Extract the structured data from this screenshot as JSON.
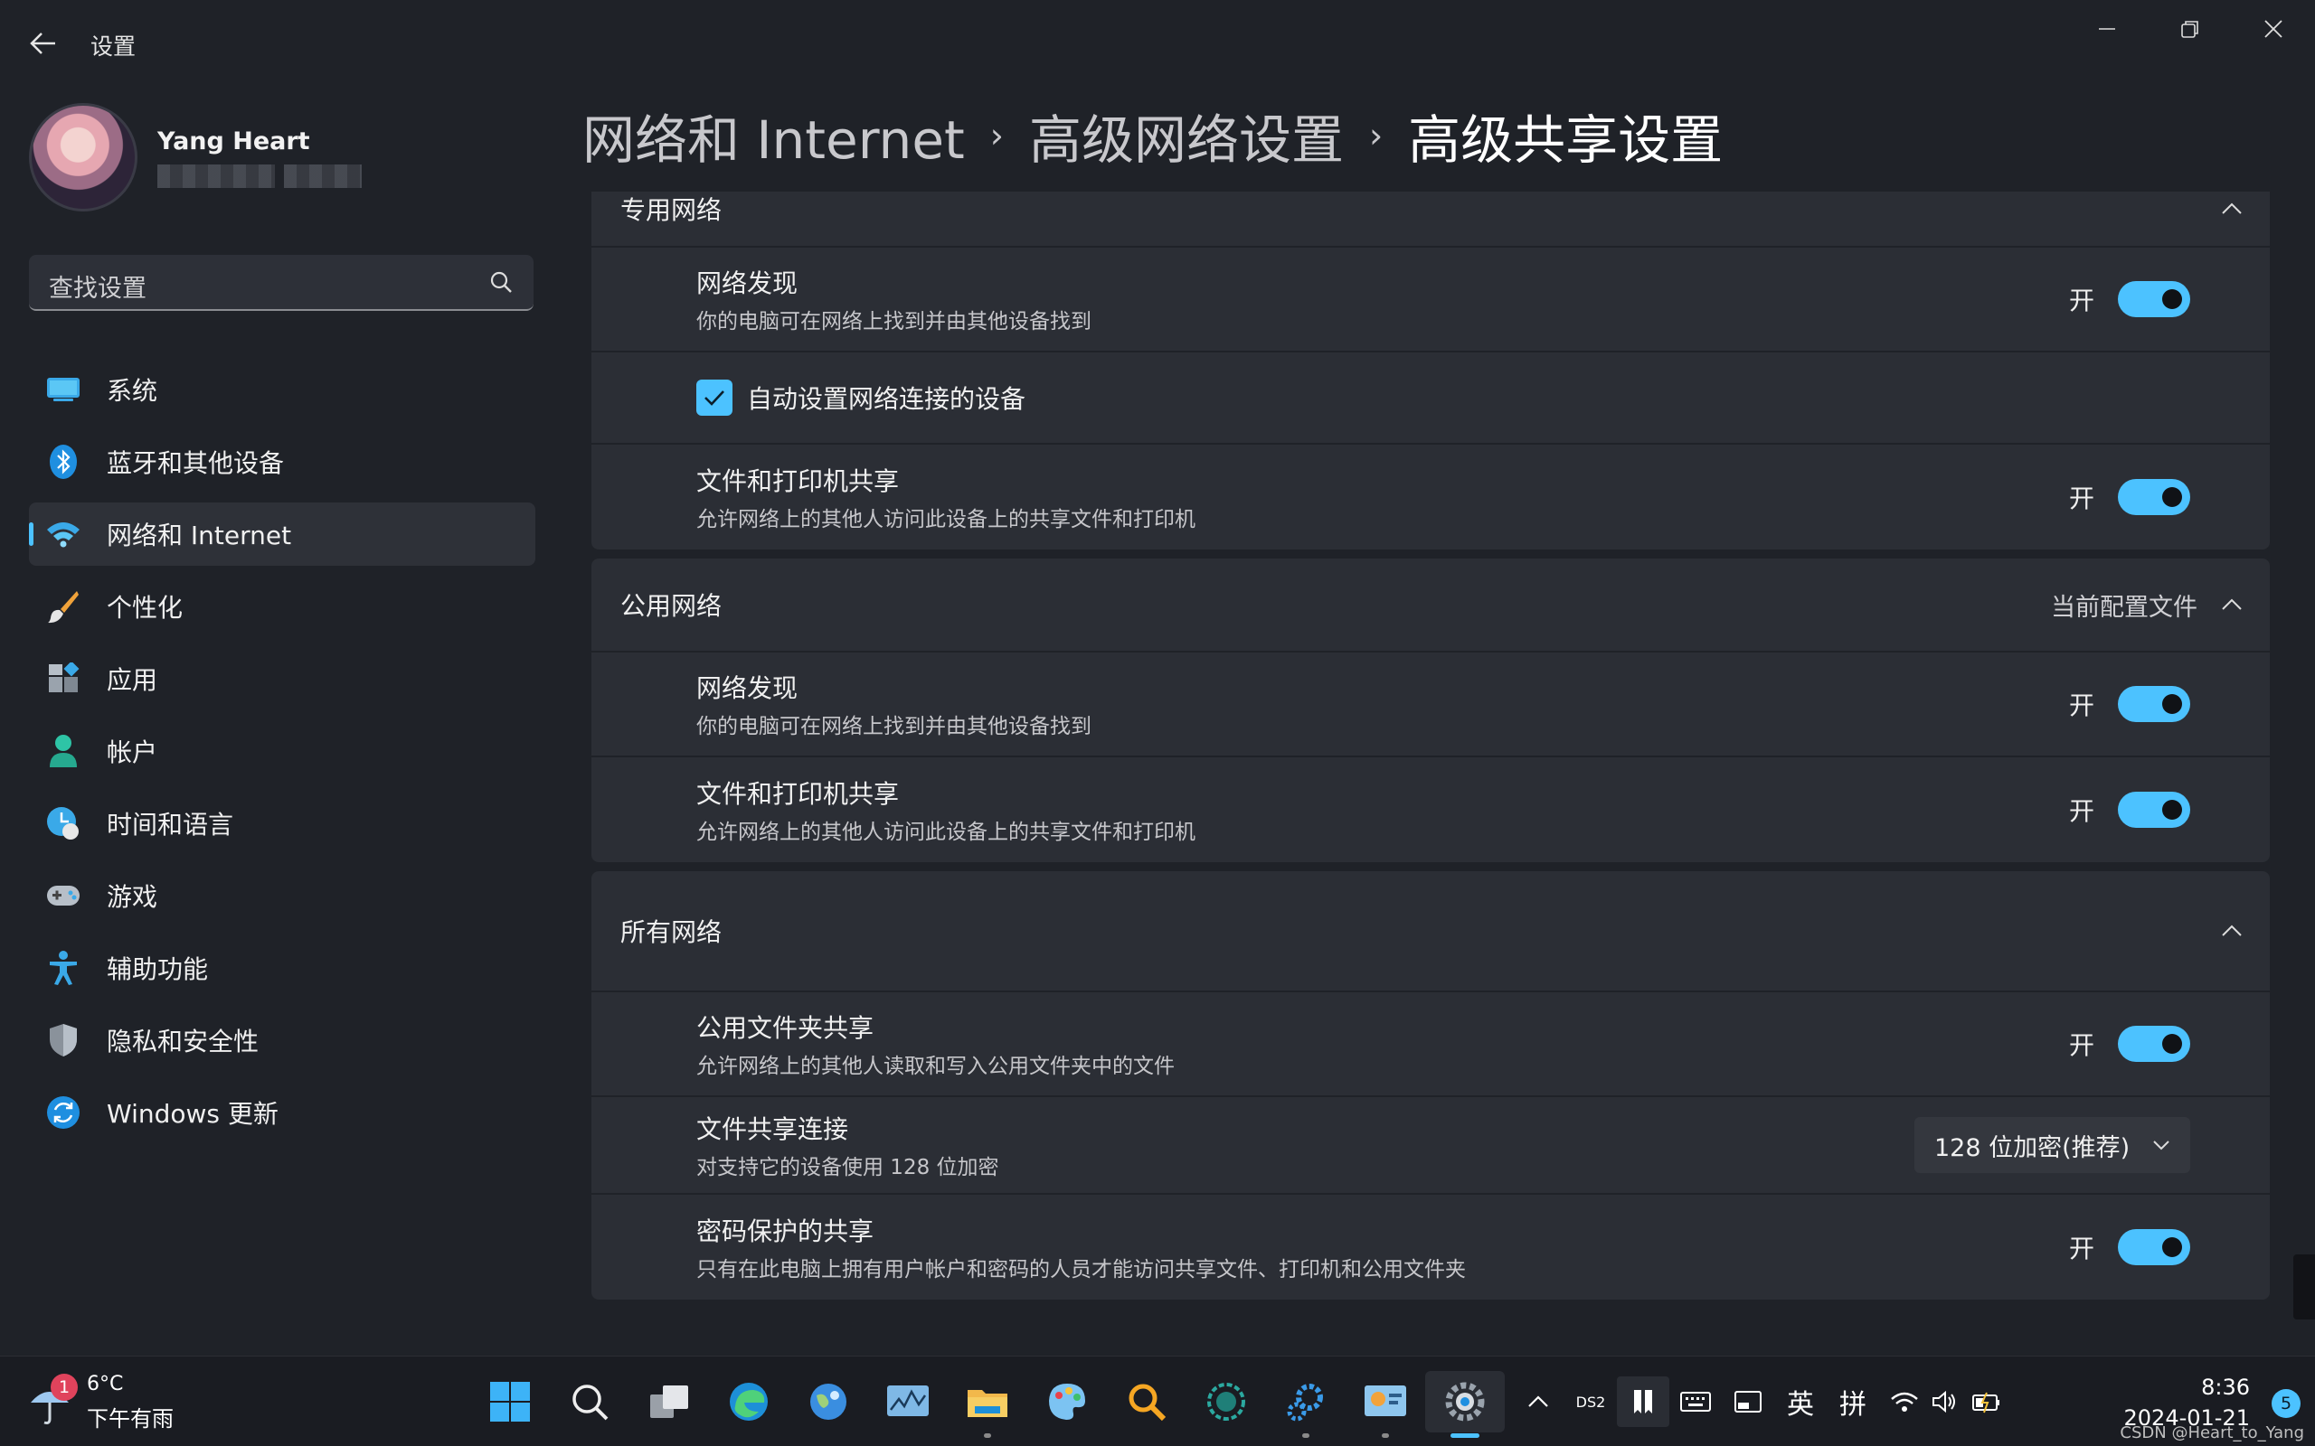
{
  "window": {
    "title": "设置"
  },
  "profile": {
    "name": "Yang Heart"
  },
  "search": {
    "placeholder": "查找设置"
  },
  "sidebar": {
    "items": [
      {
        "label": "系统",
        "icon": "system-icon"
      },
      {
        "label": "蓝牙和其他设备",
        "icon": "bluetooth-icon"
      },
      {
        "label": "网络和 Internet",
        "icon": "wifi-icon",
        "active": true
      },
      {
        "label": "个性化",
        "icon": "brush-icon"
      },
      {
        "label": "应用",
        "icon": "apps-icon"
      },
      {
        "label": "帐户",
        "icon": "account-icon"
      },
      {
        "label": "时间和语言",
        "icon": "time-language-icon"
      },
      {
        "label": "游戏",
        "icon": "gamepad-icon"
      },
      {
        "label": "辅助功能",
        "icon": "accessibility-icon"
      },
      {
        "label": "隐私和安全性",
        "icon": "shield-icon"
      },
      {
        "label": "Windows 更新",
        "icon": "update-icon"
      }
    ]
  },
  "breadcrumb": {
    "level1": "网络和 Internet",
    "level2": "高级网络设置",
    "current": "高级共享设置"
  },
  "sections": {
    "private": {
      "title": "专用网络",
      "discovery": {
        "title": "网络发现",
        "desc": "你的电脑可在网络上找到并由其他设备找到",
        "state": "开"
      },
      "auto_setup": {
        "label": "自动设置网络连接的设备",
        "checked": true
      },
      "file_sharing": {
        "title": "文件和打印机共享",
        "desc": "允许网络上的其他人访问此设备上的共享文件和打印机",
        "state": "开"
      }
    },
    "public": {
      "title": "公用网络",
      "status": "当前配置文件",
      "discovery": {
        "title": "网络发现",
        "desc": "你的电脑可在网络上找到并由其他设备找到",
        "state": "开"
      },
      "file_sharing": {
        "title": "文件和打印机共享",
        "desc": "允许网络上的其他人访问此设备上的共享文件和打印机",
        "state": "开"
      }
    },
    "all": {
      "title": "所有网络",
      "public_folder": {
        "title": "公用文件夹共享",
        "desc": "允许网络上的其他人读取和写入公用文件夹中的文件",
        "state": "开"
      },
      "file_conn": {
        "title": "文件共享连接",
        "desc": "对支持它的设备使用 128 位加密",
        "value": "128 位加密(推荐)"
      },
      "password": {
        "title": "密码保护的共享",
        "desc": "只有在此电脑上拥有用户帐户和密码的人员才能访问共享文件、打印机和公用文件夹",
        "state": "开"
      }
    }
  },
  "taskbar": {
    "weather": {
      "temp": "6°C",
      "condition": "下午有雨",
      "badge": "1"
    },
    "tray": {
      "ds2": "DS2",
      "lang1": "英",
      "lang2": "拼"
    },
    "clock": {
      "time": "8:36",
      "date": "2024-01-21"
    },
    "notifications": "5"
  },
  "watermark": "CSDN @Heart_to_Yang",
  "colors": {
    "accent": "#4cc2ff",
    "background": "#1f2228",
    "card": "#2b2e35"
  }
}
